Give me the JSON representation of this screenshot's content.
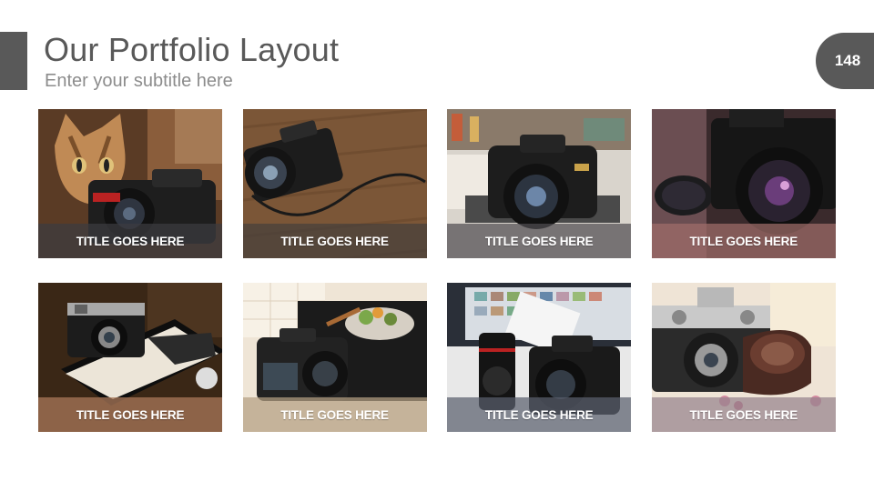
{
  "header": {
    "title": "Our Portfolio Layout",
    "subtitle": "Enter your subtitle here",
    "page_number": "148"
  },
  "colors": {
    "accent": "#595959",
    "title_text": "#595959",
    "subtitle_text": "#8c8c8c"
  },
  "portfolio": {
    "items": [
      {
        "title": "TITLE GOES HERE",
        "image": "cat-with-camera-photo",
        "caption_color": "rgba(60,60,64,0.72)"
      },
      {
        "title": "TITLE GOES HERE",
        "image": "camera-on-wood-table-photo",
        "caption_color": "rgba(70,64,60,0.72)"
      },
      {
        "title": "TITLE GOES HERE",
        "image": "dslr-on-desk-photo",
        "caption_color": "rgba(80,78,82,0.72)"
      },
      {
        "title": "TITLE GOES HERE",
        "image": "vintage-camera-sunglasses-photo",
        "caption_color": "rgba(160,110,105,0.72)"
      },
      {
        "title": "TITLE GOES HERE",
        "image": "rangefinder-on-book-photo",
        "caption_color": "rgba(170,120,90,0.75)"
      },
      {
        "title": "TITLE GOES HERE",
        "image": "camera-on-table-photo",
        "caption_color": "rgba(180,160,130,0.72)"
      },
      {
        "title": "TITLE GOES HERE",
        "image": "camera-lens-monitor-photo",
        "caption_color": "rgba(90,95,110,0.72)"
      },
      {
        "title": "TITLE GOES HERE",
        "image": "vintage-camera-film-roll-photo",
        "caption_color": "rgba(150,130,140,0.72)"
      }
    ]
  }
}
